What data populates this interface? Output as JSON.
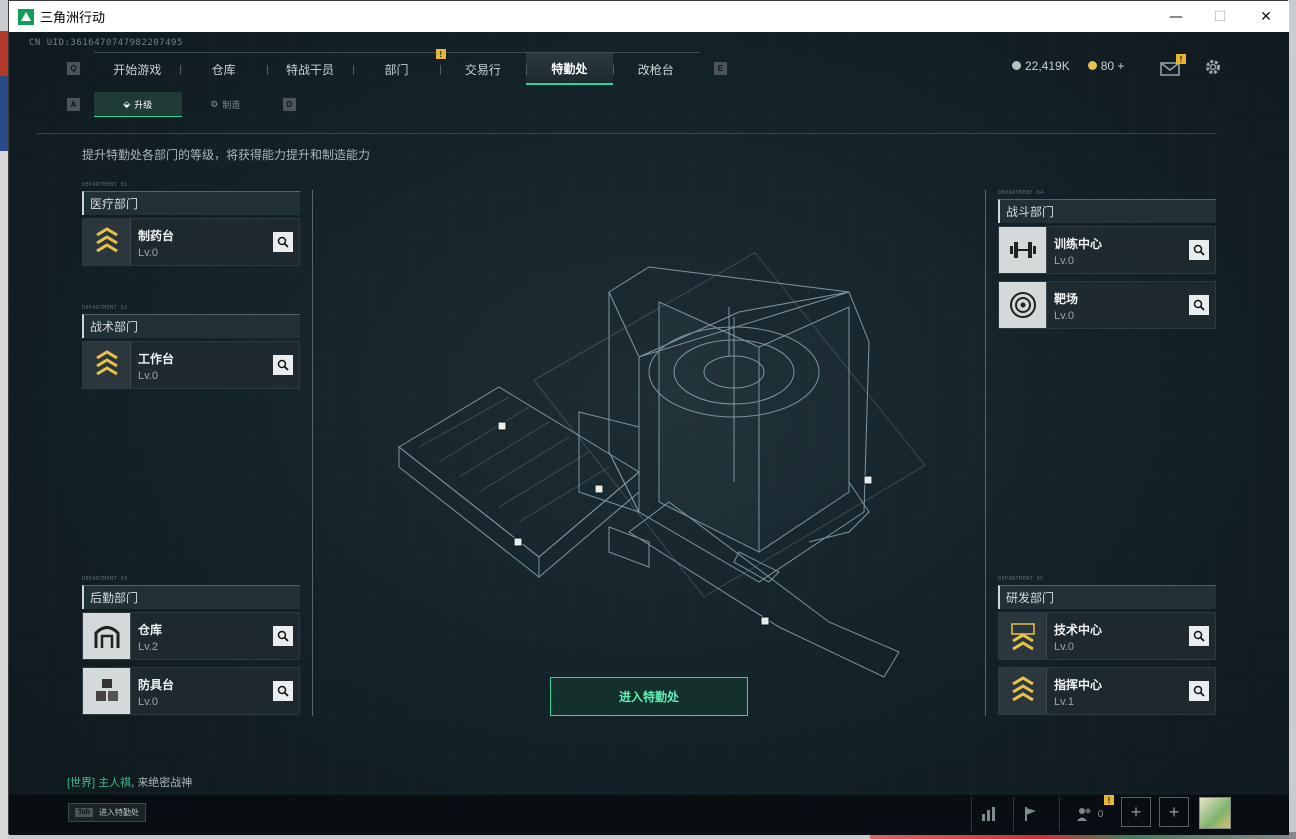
{
  "window": {
    "title": "三角洲行动",
    "min_glyph": "—",
    "max_glyph": "☐",
    "close_glyph": "✕"
  },
  "uid": "CN UID:3616470747982207495",
  "nav": {
    "left_key": "Q",
    "right_key": "E",
    "tabs": [
      {
        "label": "开始游戏",
        "active": false,
        "badge": ""
      },
      {
        "label": "仓库",
        "active": false,
        "badge": ""
      },
      {
        "label": "特战干员",
        "active": false,
        "badge": ""
      },
      {
        "label": "部门",
        "active": false,
        "badge": "!"
      },
      {
        "label": "交易行",
        "active": false,
        "badge": ""
      },
      {
        "label": "特勤处",
        "active": true,
        "badge": ""
      },
      {
        "label": "改枪台",
        "active": false,
        "badge": ""
      }
    ]
  },
  "currency": {
    "primary": "22,419K",
    "secondary": "80",
    "add": "+"
  },
  "mail_badge": "!",
  "subtabs": {
    "left_key": "A",
    "right_key": "D",
    "upgrade": "升级",
    "craft": "制造"
  },
  "description": "提升特勤处各部门的等级，将获得能力提升和制造能力",
  "departments": {
    "medical": {
      "title": "医疗部门",
      "facilities": [
        {
          "name": "制药台",
          "level": "Lv.0",
          "icon": "chevron-rank-icon"
        }
      ]
    },
    "tactical": {
      "title": "战术部门",
      "facilities": [
        {
          "name": "工作台",
          "level": "Lv.0",
          "icon": "chevron-rank-icon"
        }
      ]
    },
    "logistics": {
      "title": "后勤部门",
      "facilities": [
        {
          "name": "仓库",
          "level": "Lv.2",
          "icon": "vault-door-icon"
        },
        {
          "name": "防具台",
          "level": "Lv.0",
          "icon": "cubes-icon"
        }
      ]
    },
    "combat": {
      "title": "战斗部门",
      "facilities": [
        {
          "name": "训练中心",
          "level": "Lv.0",
          "icon": "dumbbell-icon"
        },
        {
          "name": "靶场",
          "level": "Lv.0",
          "icon": "target-icon"
        }
      ]
    },
    "research": {
      "title": "研发部门",
      "facilities": [
        {
          "name": "技术中心",
          "level": "Lv.0",
          "icon": "chevron-rank-icon"
        },
        {
          "name": "指挥中心",
          "level": "Lv.1",
          "icon": "chevron-rank-icon"
        }
      ]
    }
  },
  "enter_button": "进入特勤处",
  "chat": {
    "channel": "[世界]",
    "user": "主人祺",
    "message": "来绝密战神"
  },
  "bottom": {
    "tab_key": "Tab",
    "tab_label": "进入特勤处",
    "friends_count": "0",
    "friends_badge": "!"
  },
  "colors": {
    "accent": "#2fd69a",
    "badge": "#e8b630",
    "icon_gold": "#e8c24a"
  }
}
